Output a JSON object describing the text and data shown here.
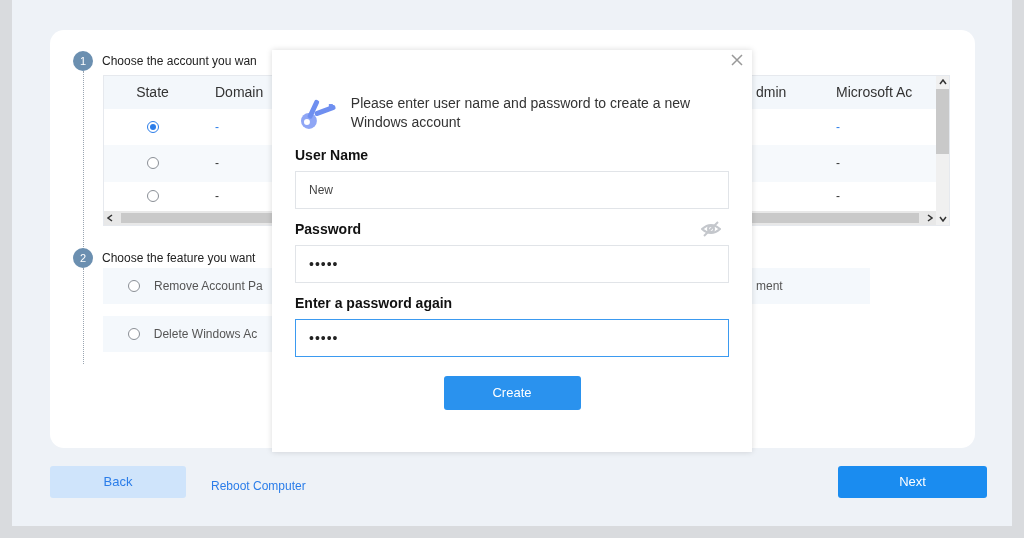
{
  "steps": [
    {
      "number": "1",
      "title": "Choose the account you wan"
    },
    {
      "number": "2",
      "title": "Choose the feature you want"
    }
  ],
  "table": {
    "columns": [
      "State",
      "Domain",
      "dmin",
      "Microsoft Ac"
    ],
    "rows": [
      {
        "selected": true,
        "domain": "-",
        "microsoft": "-"
      },
      {
        "selected": false,
        "domain": "-",
        "microsoft": "-"
      },
      {
        "selected": false,
        "domain": "-",
        "microsoft": "-"
      }
    ]
  },
  "features": [
    {
      "label": "Remove Account Pa",
      "label_end": "ment",
      "selected": false
    },
    {
      "label": "Delete Windows Ac",
      "selected": false
    }
  ],
  "dialog": {
    "message": "Please enter user name and password to create a new Windows account",
    "fields": [
      {
        "label": "User Name",
        "value": "New",
        "kind": "text",
        "focused": false
      },
      {
        "label": "Password",
        "value": "•••••",
        "kind": "password",
        "focused": false
      },
      {
        "label": "Enter a password again",
        "value": "•••••",
        "kind": "confirm",
        "focused": true
      }
    ],
    "create": "Create"
  },
  "footer": {
    "back": "Back",
    "reboot": "Reboot Computer",
    "next": "Next"
  }
}
